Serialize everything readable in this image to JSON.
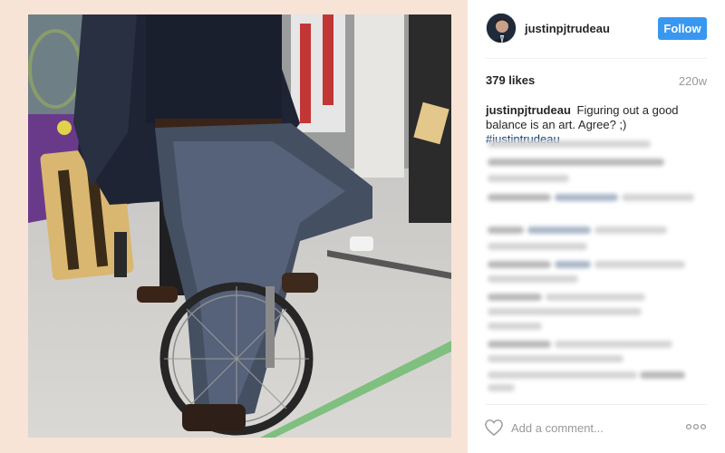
{
  "post": {
    "username": "justinpjtrudeau",
    "follow_label": "Follow",
    "likes": "379 likes",
    "age": "220w",
    "caption_user": "justinpjtrudeau",
    "caption_text": "Figuring out a good balance is an art. Agree? ;)",
    "caption_hashtag": "#justintrudeau"
  },
  "footer": {
    "comment_placeholder": "Add a comment..."
  },
  "colors": {
    "accent": "#3897f0",
    "photo_border": "#f7e4d6",
    "hashtag": "#003569"
  },
  "icons": [
    "heart-icon",
    "more-options-icon"
  ]
}
